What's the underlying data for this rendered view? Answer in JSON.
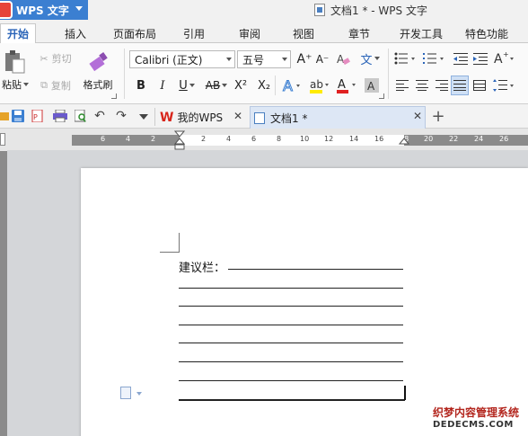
{
  "titlebar": {
    "app_name": "WPS 文字",
    "document_title": "文档1 * - WPS 文字"
  },
  "ribbon_tabs": [
    "开始",
    "插入",
    "页面布局",
    "引用",
    "审阅",
    "视图",
    "章节",
    "开发工具",
    "特色功能"
  ],
  "ribbon": {
    "paste": "粘贴",
    "cut": "剪切",
    "copy": "复制",
    "format_painter": "格式刷",
    "font_name": "Calibri (正文)",
    "font_size": "五号",
    "bold": "B",
    "italic": "I",
    "underline": "U",
    "strikethrough": "AB",
    "superscript": "X²",
    "subscript": "X₂",
    "grow_font": "A⁺",
    "shrink_font": "A⁻",
    "wen": "文",
    "font_color_letter": "A"
  },
  "doc_tabs": {
    "my_wps": "我的WPS",
    "current": "文档1 *"
  },
  "ruler_numbers": [
    "6",
    "4",
    "2",
    "2",
    "4",
    "6",
    "8",
    "10",
    "12",
    "14",
    "16",
    "18",
    "20",
    "22",
    "24",
    "26"
  ],
  "document": {
    "suggestion_label": "建议栏："
  },
  "watermark": {
    "line1": "织梦内容管理系统",
    "line2": "DEDECMS.COM"
  },
  "colors": {
    "accent": "#3b7fd1",
    "tab_active_text": "#2a64b8",
    "logo_red": "#e7443a"
  }
}
